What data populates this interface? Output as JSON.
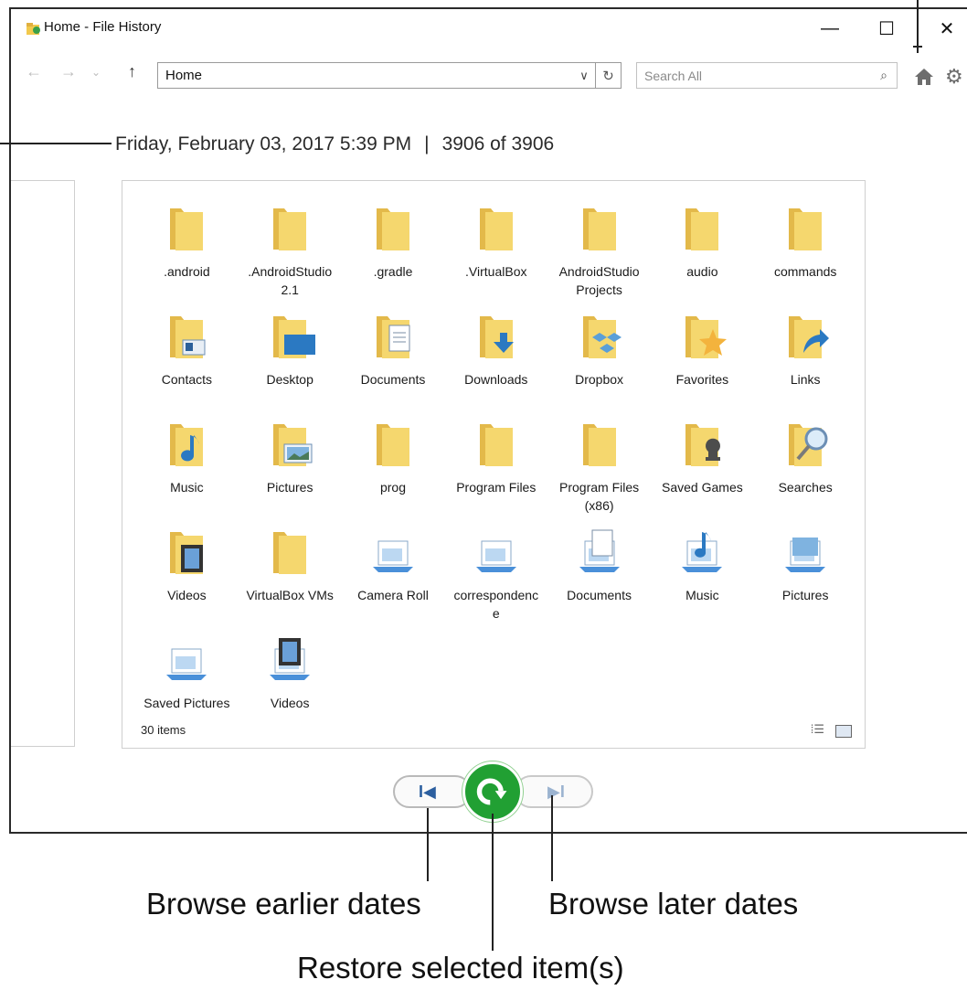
{
  "window": {
    "title": "Home - File History",
    "minimize": "—",
    "maximize": "☐",
    "close": "✕"
  },
  "navbar": {
    "back": "←",
    "forward": "→",
    "history": "⌄",
    "up": "↑",
    "address": "Home",
    "dropdown": "∨",
    "refresh": "↻",
    "search_placeholder": "Search All",
    "search_glyph": "⌕",
    "settings_glyph": "⚙"
  },
  "snapshot": {
    "date": "Friday, February 03, 2017 5:39 PM",
    "separator": "|",
    "position": "3906 of 3906"
  },
  "items": [
    {
      "label": ".android",
      "icon": "folder"
    },
    {
      "label": ".AndroidStudio2.1",
      "icon": "folder"
    },
    {
      "label": ".gradle",
      "icon": "folder"
    },
    {
      "label": ".VirtualBox",
      "icon": "folder"
    },
    {
      "label": "AndroidStudioProjects",
      "icon": "folder"
    },
    {
      "label": "audio",
      "icon": "folder"
    },
    {
      "label": "commands",
      "icon": "folder"
    },
    {
      "label": "Contacts",
      "icon": "contacts"
    },
    {
      "label": "Desktop",
      "icon": "desktop"
    },
    {
      "label": "Documents",
      "icon": "documents"
    },
    {
      "label": "Downloads",
      "icon": "downloads"
    },
    {
      "label": "Dropbox",
      "icon": "dropbox"
    },
    {
      "label": "Favorites",
      "icon": "favorites"
    },
    {
      "label": "Links",
      "icon": "links"
    },
    {
      "label": "Music",
      "icon": "music"
    },
    {
      "label": "Pictures",
      "icon": "pictures"
    },
    {
      "label": "prog",
      "icon": "folder"
    },
    {
      "label": "Program Files",
      "icon": "folder"
    },
    {
      "label": "Program Files (x86)",
      "icon": "folder"
    },
    {
      "label": "Saved Games",
      "icon": "games"
    },
    {
      "label": "Searches",
      "icon": "searches"
    },
    {
      "label": "Videos",
      "icon": "videos"
    },
    {
      "label": "VirtualBox VMs",
      "icon": "folder"
    },
    {
      "label": "Camera Roll",
      "icon": "lib-generic"
    },
    {
      "label": "correspondence",
      "icon": "lib-generic"
    },
    {
      "label": "Documents",
      "icon": "lib-documents"
    },
    {
      "label": "Music",
      "icon": "lib-music"
    },
    {
      "label": "Pictures",
      "icon": "lib-pictures"
    },
    {
      "label": "Saved Pictures",
      "icon": "lib-generic"
    },
    {
      "label": "Videos",
      "icon": "lib-videos"
    }
  ],
  "status": {
    "count": "30 items",
    "details_glyph": "⁞☰"
  },
  "controls": {
    "previous_glyph": "I◀",
    "next_glyph": "▶I"
  },
  "callouts": {
    "earlier": "Browse earlier dates",
    "later": "Browse later dates",
    "restore": "Restore selected item(s)"
  },
  "colors": {
    "folder": "#f5d76e",
    "folder_dark": "#e3b94a",
    "accent_blue": "#2b79c2",
    "restore_green": "#21a033"
  }
}
